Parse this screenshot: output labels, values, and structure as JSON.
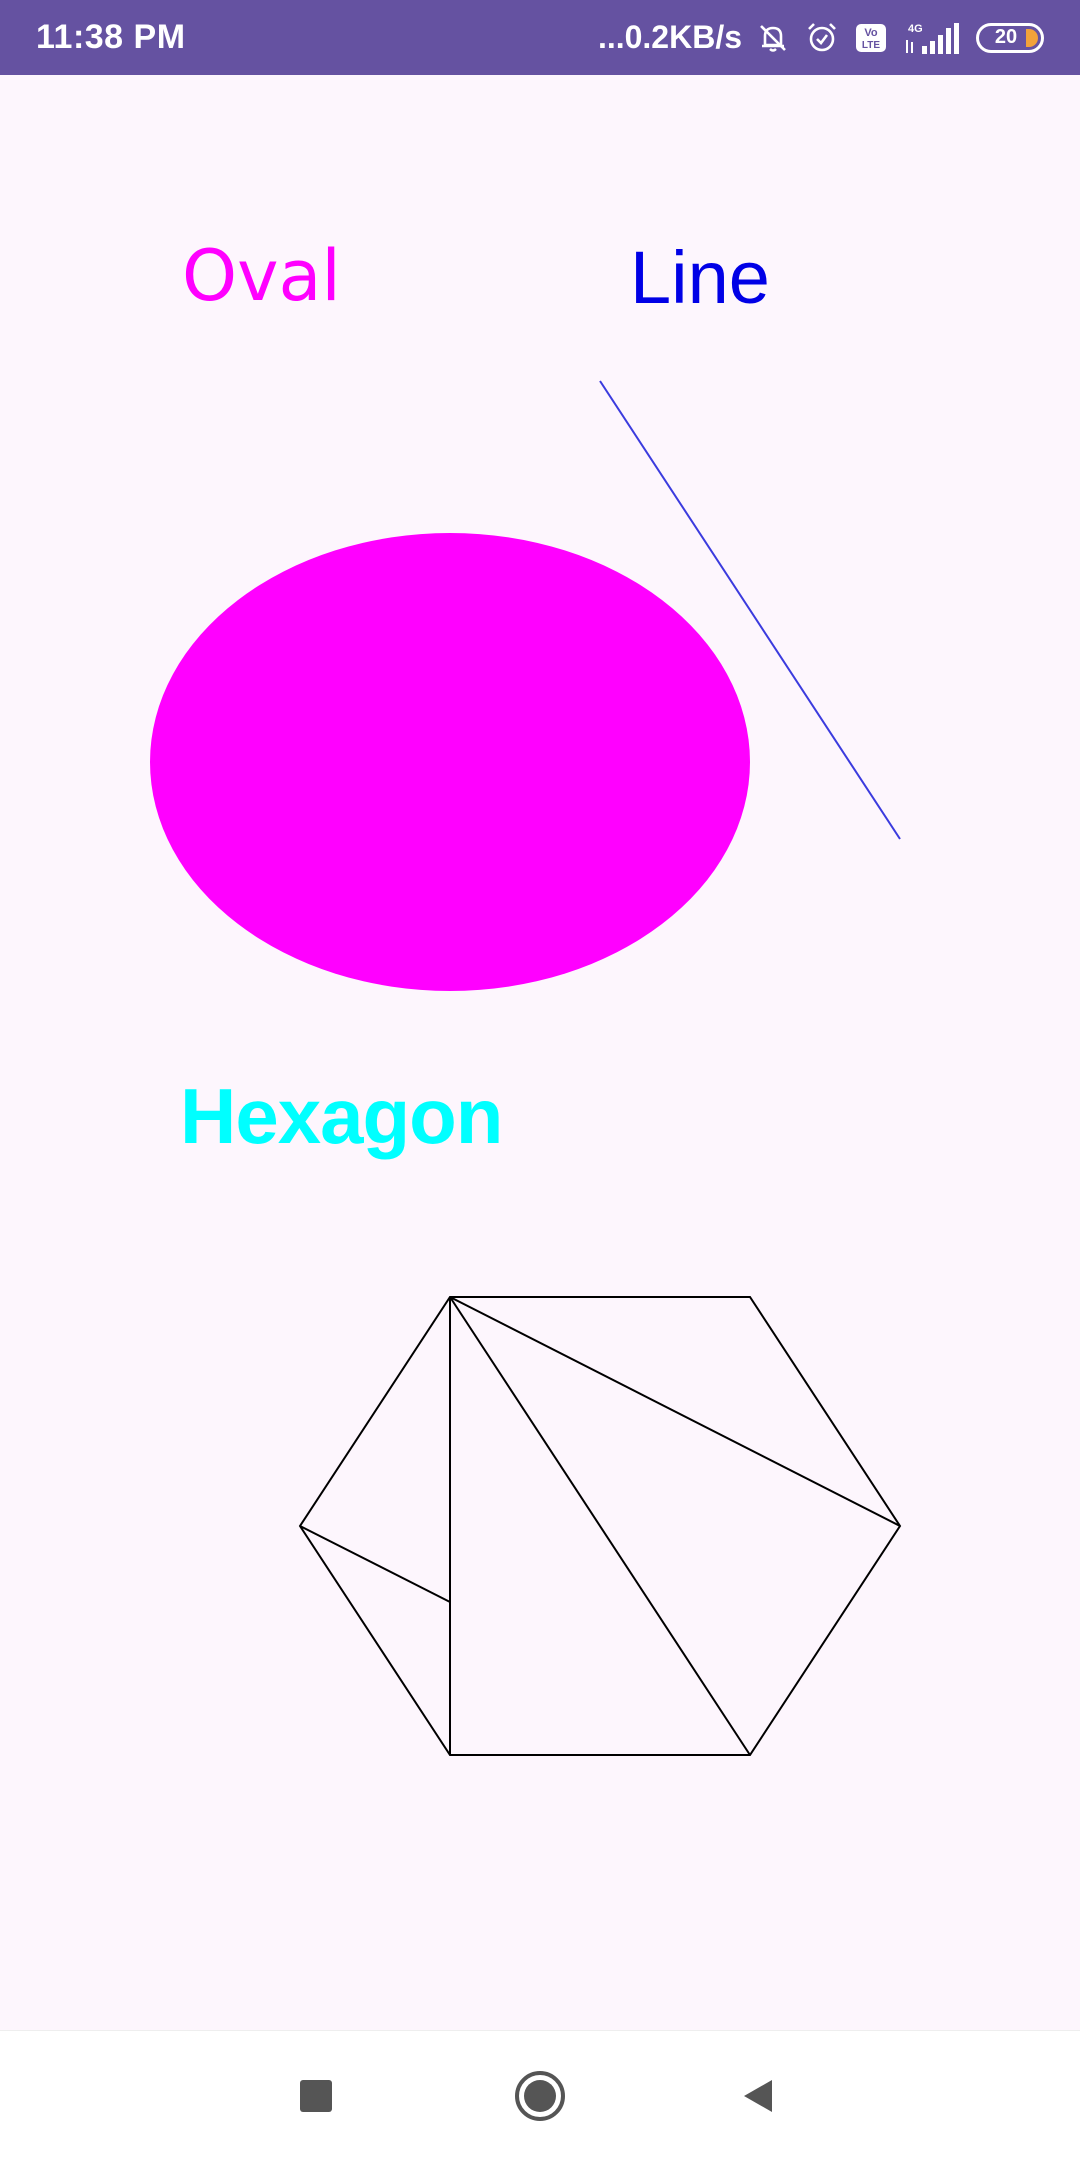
{
  "status_bar": {
    "time": "11:38 PM",
    "net_speed": "...0.2KB/s",
    "battery": "20",
    "icons": [
      "mute-bell-icon",
      "alarm-icon",
      "volte-icon",
      "4g-signal-icon",
      "battery-icon"
    ]
  },
  "canvas": {
    "oval_label": "Oval",
    "line_label": "Line",
    "hexagon_label": "Hexagon",
    "colors": {
      "oval": "#ff00ff",
      "line": "#0000e6",
      "hexagon_label": "#00ffff",
      "hexagon_stroke": "#000000"
    }
  },
  "nav_bar": {
    "icons": [
      "recent-apps-icon",
      "home-icon",
      "back-icon"
    ]
  }
}
